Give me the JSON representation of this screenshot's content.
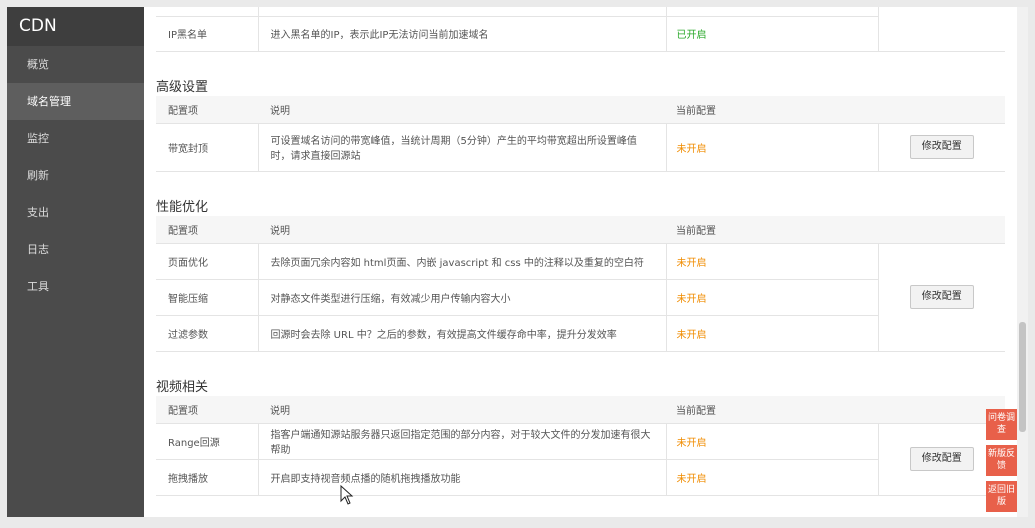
{
  "sidebar": {
    "brand": "CDN",
    "items": [
      {
        "label": "概览"
      },
      {
        "label": "域名管理"
      },
      {
        "label": "监控"
      },
      {
        "label": "刷新"
      },
      {
        "label": "支出"
      },
      {
        "label": "日志"
      },
      {
        "label": "工具"
      }
    ]
  },
  "blacklist_row": {
    "name": "IP黑名单",
    "desc": "进入黑名单的IP，表示此IP无法访问当前加速域名",
    "status": "已开启"
  },
  "headers": {
    "item": "配置项",
    "desc": "说明",
    "current": "当前配置"
  },
  "button_label": "修改配置",
  "advanced": {
    "title": "高级设置",
    "rows": [
      {
        "name": "带宽封顶",
        "desc": "可设置域名访问的带宽峰值，当统计周期（5分钟）产生的平均带宽超出所设置峰值时，请求直接回源站",
        "status": "未开启"
      }
    ]
  },
  "performance": {
    "title": "性能优化",
    "rows": [
      {
        "name": "页面优化",
        "desc": "去除页面冗余内容如 html页面、内嵌 javascript 和 css 中的注释以及重复的空白符",
        "status": "未开启"
      },
      {
        "name": "智能压缩",
        "desc": "对静态文件类型进行压缩，有效减少用户传输内容大小",
        "status": "未开启"
      },
      {
        "name": "过滤参数",
        "desc": "回源时会去除 URL 中？之后的参数，有效提高文件缓存命中率，提升分发效率",
        "status": "未开启"
      }
    ]
  },
  "video": {
    "title": "视频相关",
    "rows": [
      {
        "name": "Range回源",
        "desc": "指客户端通知源站服务器只返回指定范围的部分内容，对于较大文件的分发加速有很大帮助",
        "status": "未开启"
      },
      {
        "name": "拖拽播放",
        "desc": "开启即支持视音频点播的随机拖拽播放功能",
        "status": "未开启"
      }
    ]
  },
  "float_buttons": {
    "survey": "问卷调查",
    "feedback": "新版反馈",
    "old": "返回旧版"
  },
  "colors": {
    "on": "#2aa82a",
    "off": "#f08c00",
    "float": "#e8604a"
  }
}
